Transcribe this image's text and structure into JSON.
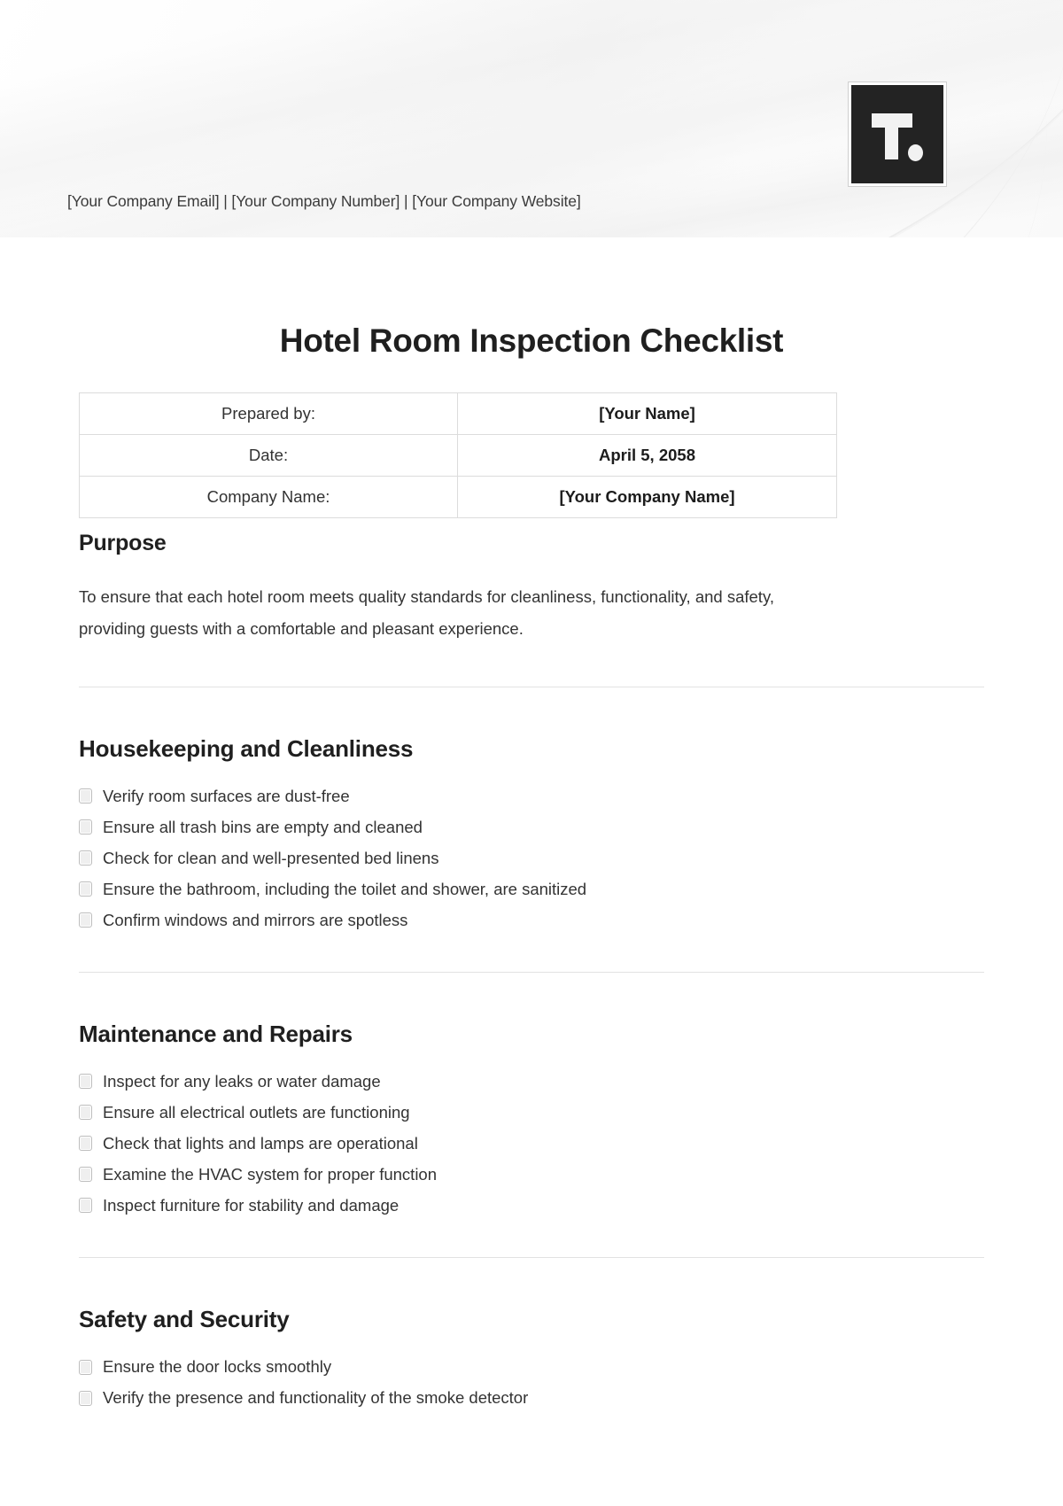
{
  "header": {
    "logo_alt": "T.",
    "contact_line": "[Your Company Email] | [Your Company Number] | [Your Company Website]"
  },
  "document": {
    "title": "Hotel Room Inspection Checklist",
    "info_table": {
      "rows": [
        {
          "label": "Prepared by:",
          "value": "[Your Name]"
        },
        {
          "label": "Date:",
          "value": "April 5, 2058"
        },
        {
          "label": "Company Name:",
          "value": "[Your Company Name]"
        }
      ]
    },
    "purpose": {
      "heading": "Purpose",
      "body": "To ensure that each hotel room meets quality standards for cleanliness, functionality, and safety, providing guests with a comfortable and pleasant experience."
    },
    "sections": [
      {
        "heading": "Housekeeping and Cleanliness",
        "items": [
          "Verify room surfaces are dust-free",
          "Ensure all trash bins are empty and cleaned",
          "Check for clean and well-presented bed linens",
          "Ensure the bathroom, including the toilet and shower, are sanitized",
          "Confirm windows and mirrors are spotless"
        ]
      },
      {
        "heading": "Maintenance and Repairs",
        "items": [
          "Inspect for any leaks or water damage",
          "Ensure all electrical outlets are functioning",
          "Check that lights and lamps are operational",
          "Examine the HVAC system for proper function",
          "Inspect furniture for stability and damage"
        ]
      },
      {
        "heading": "Safety and Security",
        "items": [
          "Ensure the door locks smoothly",
          "Verify the presence and functionality of the smoke detector"
        ]
      }
    ]
  },
  "colors": {
    "logo_background": "#232323",
    "text_primary": "#1f1f1f",
    "text_body": "#333333",
    "table_border": "#dcdcdc",
    "divider": "#e2e2e2",
    "checkbox_fill": "#efefef"
  }
}
